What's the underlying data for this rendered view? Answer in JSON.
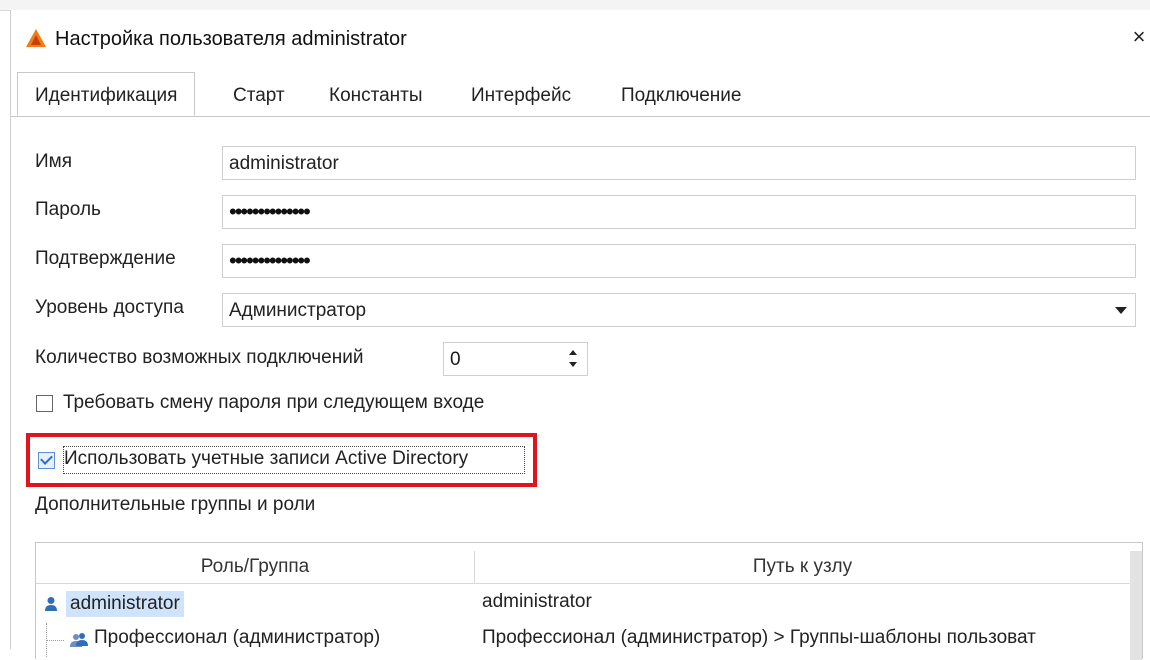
{
  "dialog": {
    "title": "Настройка пользователя administrator",
    "close_glyph": "×"
  },
  "tabs": [
    {
      "label": "Идентификация",
      "active": true
    },
    {
      "label": "Старт",
      "active": false
    },
    {
      "label": "Константы",
      "active": false
    },
    {
      "label": "Интерфейс",
      "active": false
    },
    {
      "label": "Подключение",
      "active": false
    }
  ],
  "form": {
    "name_label": "Имя",
    "name_value": "administrator",
    "password_label": "Пароль",
    "password_value": "••••••••••••••",
    "confirm_label": "Подтверждение",
    "confirm_value": "••••••••••••••",
    "access_label": "Уровень доступа",
    "access_value": "Администратор",
    "connections_label": "Количество возможных подключений",
    "connections_value": "0",
    "require_change_label": "Требовать смену пароля при следующем входе",
    "require_change_checked": false,
    "use_ad_label": "Использовать учетные записи Active Directory",
    "use_ad_checked": true,
    "groups_label": "Дополнительные группы и роли"
  },
  "table": {
    "columns": [
      "Роль/Группа",
      "Путь к узлу"
    ],
    "rows": [
      {
        "role": "administrator",
        "path": "administrator",
        "icon": "user-icon",
        "selected": true
      },
      {
        "role": "Профессионал (администратор)",
        "path": "Профессионал (администратор) > Группы-шаблоны пользоват",
        "icon": "group-icon",
        "selected": false
      }
    ]
  },
  "colors": {
    "highlight": "#e0141e",
    "app_icon_orange": "#f07c14",
    "user_icon_blue": "#2f6fb6",
    "selection": "#cfe3fa"
  }
}
